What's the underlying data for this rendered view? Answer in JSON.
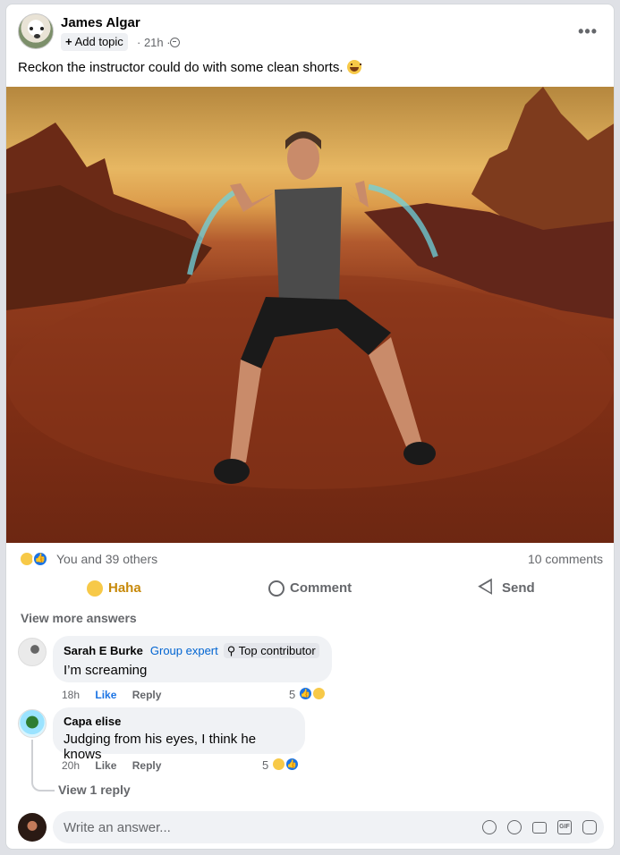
{
  "post": {
    "author": "James Algar",
    "add_topic": "Add topic",
    "time": "· 21h ·",
    "text": "Reckon the instructor could do with some clean shorts.",
    "more_icon": "•••"
  },
  "reactions": {
    "summary": "You and 39 others",
    "comments_count": "10 comments"
  },
  "actions": {
    "haha": "Haha",
    "comment": "Comment",
    "send": "Send"
  },
  "view_more": "View more answers",
  "comments": [
    {
      "name": "Sarah E Burke",
      "badge_expert": "Group expert",
      "badge_top": "Top contributor",
      "text": "I’m screaming",
      "time": "18h",
      "like": "Like",
      "reply": "Reply",
      "reaction_count": "5"
    },
    {
      "name": "Capa elise",
      "text": "Judging from his eyes, I think he knows",
      "time": "20h",
      "like": "Like",
      "reply": "Reply",
      "reaction_count": "5"
    }
  ],
  "view_reply": "View 1 reply",
  "composer": {
    "placeholder": "Write an answer..."
  },
  "colors": {
    "accent": "#1b74e4",
    "haha": "#c7890a",
    "secondary_text": "#65676b"
  }
}
